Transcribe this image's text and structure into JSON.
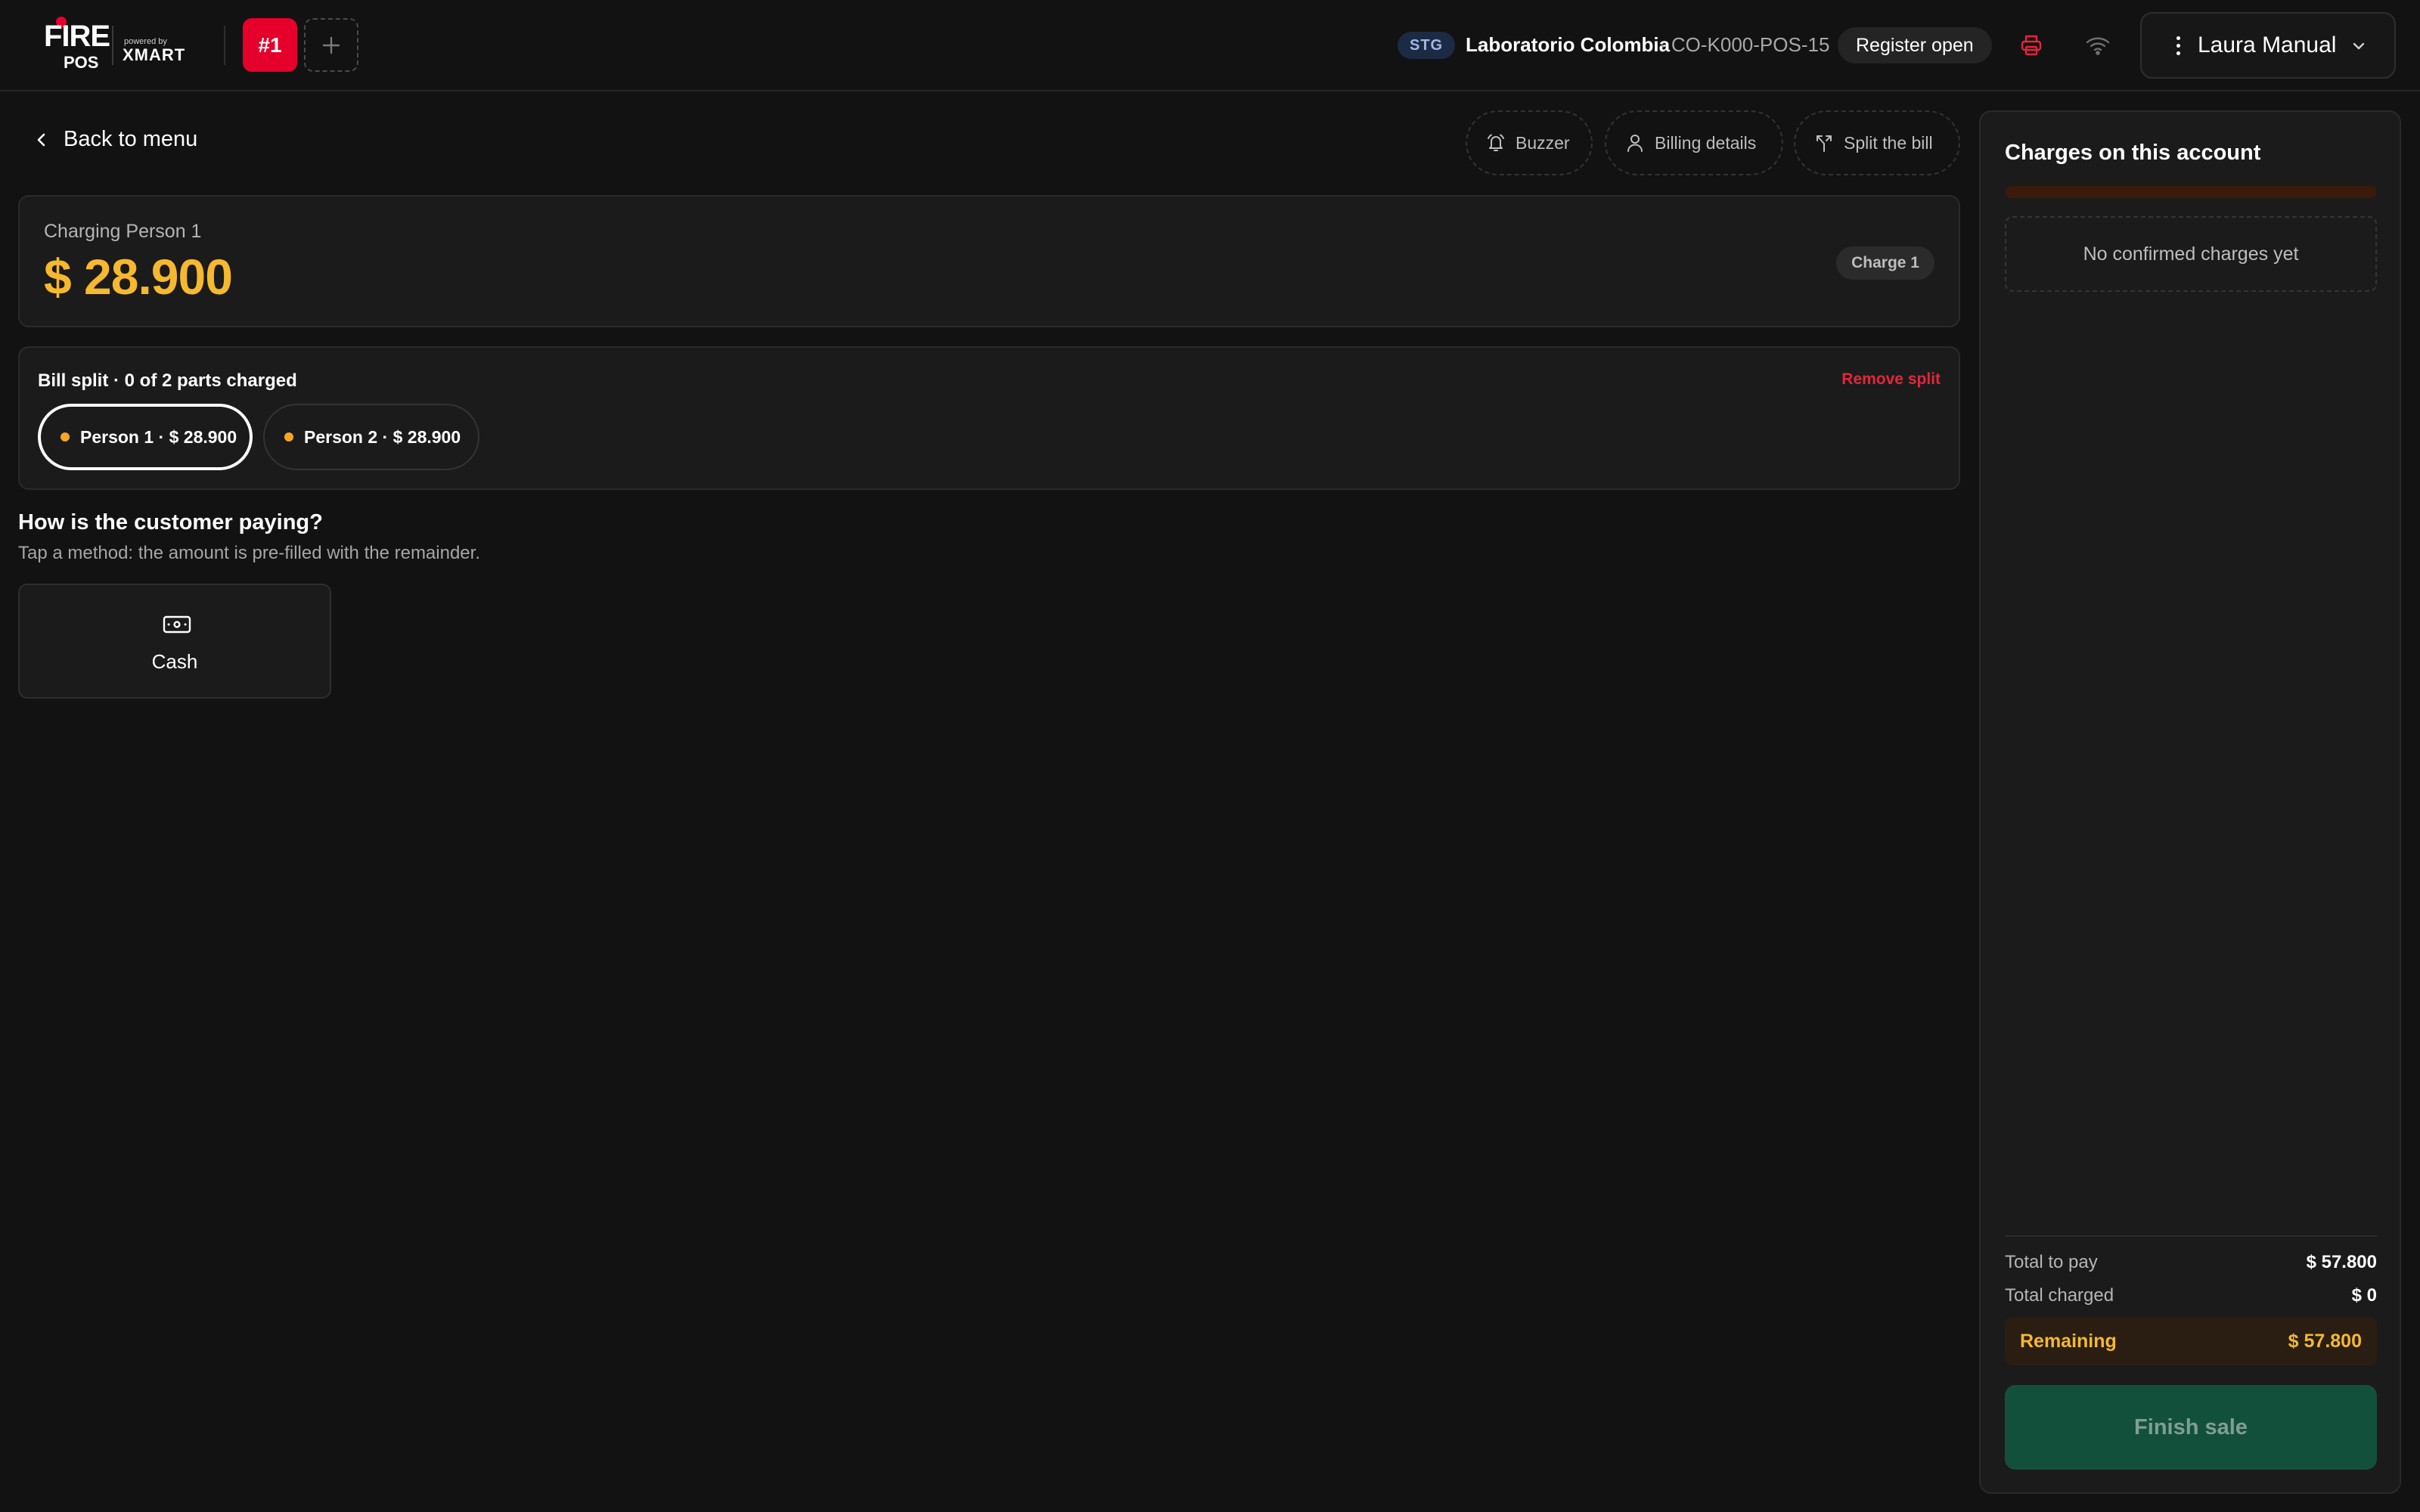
{
  "brand": {
    "logo_top": "FIRE",
    "logo_bottom": "POS",
    "powered_by": "powered by",
    "partner": "XMART",
    "colors": {
      "accent": "#e4002b",
      "amount": "#f5b82e",
      "finish": "#13503b"
    }
  },
  "topbar": {
    "order_tab": "#1",
    "add_tab_icon": "plus-icon",
    "env_badge": "STG",
    "store_name": "Laboratorio Colombia",
    "store_code": "· CO-K000-POS-15",
    "register_status": "Register open",
    "print_icon": "printer-icon",
    "wifi_icon": "wifi-icon",
    "user_name": "Laura Manual"
  },
  "main": {
    "back_label": "Back to menu",
    "actions": {
      "buzzer": "Buzzer",
      "billing": "Billing details",
      "split": "Split the bill"
    },
    "charge": {
      "label": "Charging Person 1",
      "amount": "$ 28.900",
      "chip": "Charge 1"
    },
    "split": {
      "title": "Bill split · 0 of 2 parts charged",
      "remove": "Remove split",
      "people": [
        {
          "label": "Person 1 · $ 28.900",
          "selected": true
        },
        {
          "label": "Person 2 · $ 28.900",
          "selected": false
        }
      ]
    },
    "payment": {
      "heading": "How is the customer paying?",
      "subheading": "Tap a method: the amount is pre-filled with the remainder.",
      "methods": [
        {
          "label": "Cash",
          "icon": "cash-icon"
        }
      ]
    }
  },
  "panel": {
    "title": "Charges on this account",
    "progress": 0,
    "empty_text": "No confirmed charges yet",
    "total_to_pay_label": "Total to pay",
    "total_to_pay": "$ 57.800",
    "total_charged_label": "Total charged",
    "total_charged": "$ 0",
    "remaining_label": "Remaining",
    "remaining": "$ 57.800",
    "finish_label": "Finish sale"
  }
}
